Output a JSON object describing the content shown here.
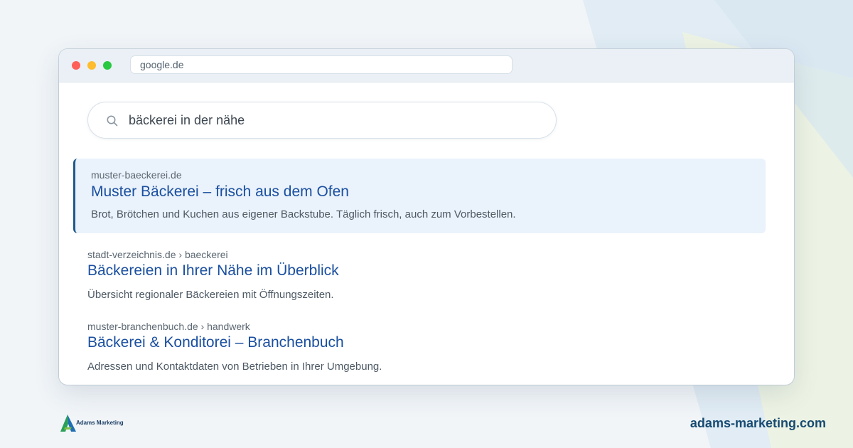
{
  "browser": {
    "url": "google.de"
  },
  "search": {
    "query": "bäckerei in der nähe"
  },
  "results": [
    {
      "url": "muster-baeckerei.de",
      "title": "Muster Bäckerei – frisch aus dem Ofen",
      "description": "Brot, Brötchen und Kuchen aus eigener Backstube. Täglich frisch, auch zum Vorbestellen.",
      "highlighted": true
    },
    {
      "url": "stadt-verzeichnis.de › baeckerei",
      "title": "Bäckereien in Ihrer Nähe im Überblick",
      "description": "Übersicht regionaler Bäckereien mit Öffnungszeiten."
    },
    {
      "url": "muster-branchenbuch.de › handwerk",
      "title": "Bäckerei & Konditorei – Branchenbuch",
      "description": "Adressen und Kontaktdaten von Betrieben in Ihrer Umgebung."
    }
  ],
  "footer": {
    "brand_name": "Adams Marketing",
    "website": "adams-marketing.com"
  },
  "colors": {
    "accent": "#1e5a8c",
    "link": "#1a4fa0",
    "highlight_bg": "#eaf2fb",
    "page_bg": "#f1f5f8"
  },
  "icons": [
    "search-icon",
    "brand-logo-icon"
  ]
}
